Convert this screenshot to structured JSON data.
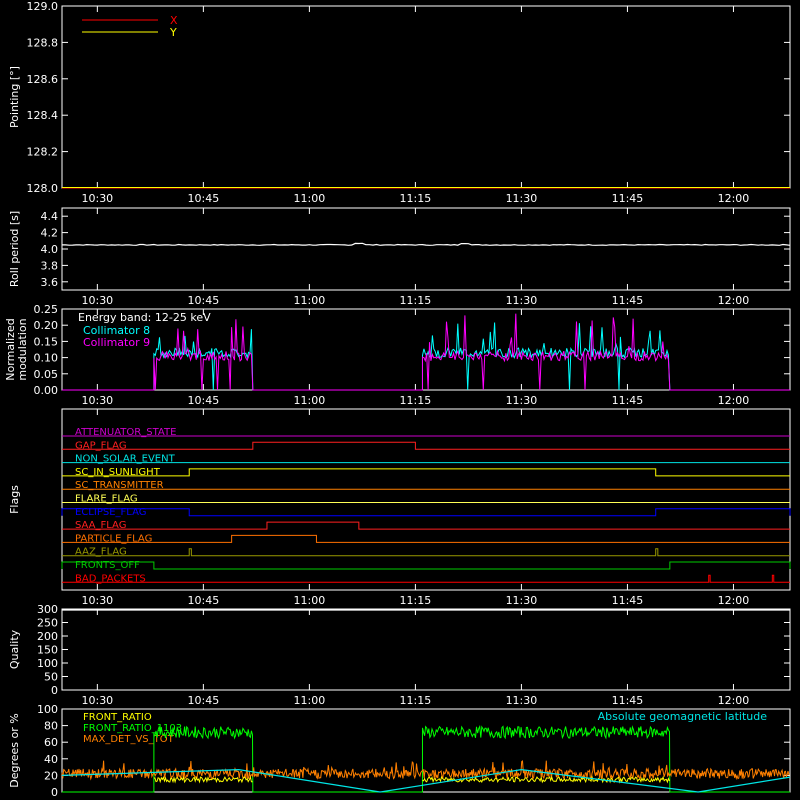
{
  "chart_data": [
    {
      "type": "line",
      "id": "pointing",
      "ylabel": "Pointing [°]",
      "ylim": [
        128.0,
        129.0
      ],
      "yticks": [
        "128.0",
        "128.2",
        "128.4",
        "128.6",
        "128.8",
        "129.0"
      ],
      "xticks": [
        "10:30",
        "10:45",
        "11:00",
        "11:15",
        "11:30",
        "11:45",
        "12:00"
      ],
      "xlim_minutes": [
        625,
        728
      ],
      "series": [
        {
          "name": "X",
          "color": "#ff0000",
          "x": [
            625,
            728
          ],
          "y": [
            128.0,
            128.0
          ]
        },
        {
          "name": "Y",
          "color": "#ffff00",
          "x": [
            625,
            728
          ],
          "y": [
            128.0,
            128.0
          ]
        }
      ]
    },
    {
      "type": "line",
      "id": "roll",
      "ylabel": "Roll period [s]",
      "ylim": [
        3.5,
        4.5
      ],
      "yticks": [
        "3.6",
        "3.8",
        "4.0",
        "4.2",
        "4.4"
      ],
      "xticks": [
        "10:30",
        "10:45",
        "11:00",
        "11:15",
        "11:30",
        "11:45",
        "12:00"
      ],
      "series": [
        {
          "color": "#ffffff",
          "x": [
            625,
            640,
            655,
            670,
            685,
            700,
            715,
            728
          ],
          "y": [
            4.05,
            4.04,
            4.05,
            4.06,
            4.05,
            4.05,
            4.05,
            4.05
          ]
        }
      ]
    },
    {
      "type": "line",
      "id": "modulation",
      "ylabel": "Normalized modulation",
      "ylim": [
        0.0,
        0.25
      ],
      "yticks": [
        "0.00",
        "0.05",
        "0.10",
        "0.15",
        "0.20",
        "0.25"
      ],
      "xticks": [
        "10:30",
        "10:45",
        "11:00",
        "11:15",
        "11:30",
        "11:45",
        "12:00"
      ],
      "annotation": "Energy band: 12-25 keV",
      "series": [
        {
          "name": "Collimator 8",
          "color": "#00ffff",
          "segments": [
            [
              638,
              652
            ],
            [
              676,
              711
            ]
          ],
          "level": 0.1,
          "peak": 0.21
        },
        {
          "name": "Collimator 9",
          "color": "#ff00ff",
          "segments": [
            [
              638,
              652
            ],
            [
              676,
              711
            ]
          ],
          "level": 0.09,
          "peak": 0.24
        }
      ]
    },
    {
      "type": "line",
      "id": "flags",
      "ylabel": "Flags",
      "xticks": [
        "10:30",
        "10:45",
        "11:00",
        "11:15",
        "11:30",
        "11:45",
        "12:00"
      ],
      "flags": [
        {
          "name": "ATTENUATOR_STATE",
          "color": "#cc00cc",
          "high": []
        },
        {
          "name": "GAP_FLAG",
          "color": "#ff2020",
          "high": [
            [
              652,
              675
            ]
          ]
        },
        {
          "name": "NON_SOLAR_EVENT",
          "color": "#00e5e5",
          "high": []
        },
        {
          "name": "SC_IN_SUNLIGHT",
          "color": "#ffff00",
          "high": [
            [
              643,
              709
            ]
          ]
        },
        {
          "name": "SC_TRANSMITTER",
          "color": "#ff8000",
          "high": []
        },
        {
          "name": "FLARE_FLAG",
          "color": "#ffff55",
          "high": []
        },
        {
          "name": "ECLIPSE_FLAG",
          "color": "#0000ff",
          "high": [
            [
              625,
              643
            ],
            [
              709,
              728
            ]
          ]
        },
        {
          "name": "SAA_FLAG",
          "color": "#ff2020",
          "high": [
            [
              654,
              667
            ]
          ]
        },
        {
          "name": "PARTICLE_FLAG",
          "color": "#ff7000",
          "high": [
            [
              649,
              661
            ]
          ]
        },
        {
          "name": "AAZ_FLAG",
          "color": "#999900",
          "high": [
            [
              643,
              643.3
            ],
            [
              709,
              709.3
            ]
          ]
        },
        {
          "name": "FRONTS_OFF",
          "color": "#00cc00",
          "high": [
            [
              625,
              638
            ],
            [
              711,
              728
            ]
          ]
        },
        {
          "name": "BAD_PACKETS",
          "color": "#ff0000",
          "high": [
            [
              716.5,
              716.7
            ],
            [
              725.5,
              725.7
            ]
          ]
        }
      ]
    },
    {
      "type": "line",
      "id": "quality",
      "ylabel": "Quality",
      "ylim": [
        0,
        300
      ],
      "yticks": [
        "0",
        "50",
        "100",
        "150",
        "200",
        "250",
        "300"
      ],
      "xticks": [
        "10:30",
        "10:45",
        "11:00",
        "11:15",
        "11:30",
        "11:45",
        "12:00"
      ],
      "series": [
        {
          "color": "#ffffff",
          "x": [
            625,
            728
          ],
          "y": [
            300,
            300
          ]
        }
      ]
    },
    {
      "type": "line",
      "id": "ratios",
      "ylabel": "Degrees or %",
      "ylim": [
        0,
        100
      ],
      "yticks": [
        "0",
        "20",
        "40",
        "60",
        "80",
        "100"
      ],
      "annotation": "Absolute geomagnetic latitude",
      "series": [
        {
          "name": "FRONT_RATIO",
          "color": "#ffff00",
          "level": 15
        },
        {
          "name": "FRONT_RATIO_1103",
          "color": "#00ff00",
          "segments": [
            [
              638,
              652
            ],
            [
              676,
              711
            ]
          ],
          "level": 72
        },
        {
          "name": "MAX_DET_VS_TOT",
          "color": "#ff8000",
          "level": 22
        },
        {
          "name": "Absolute geomagnetic latitude",
          "color": "#00e5e5",
          "x": [
            625,
            650,
            670,
            690,
            715,
            728
          ],
          "y": [
            20,
            27,
            0,
            27,
            0,
            18
          ]
        }
      ]
    }
  ]
}
